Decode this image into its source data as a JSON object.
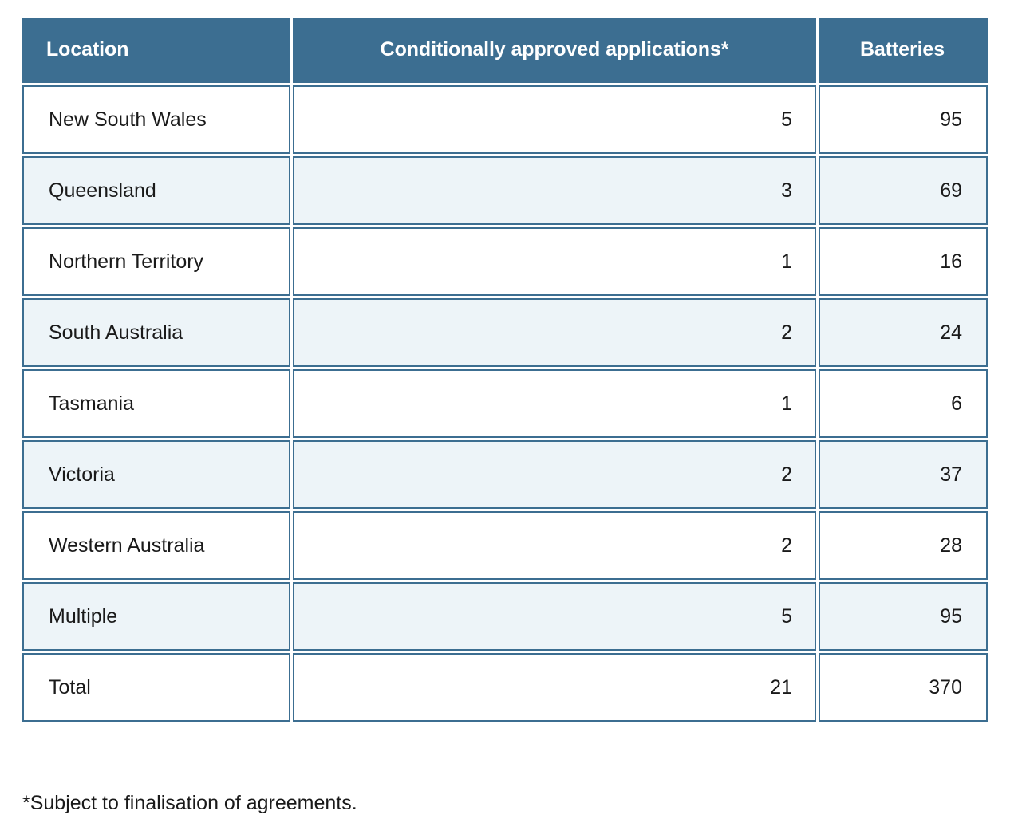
{
  "table": {
    "columns": [
      {
        "key": "location",
        "label": "Location",
        "align": "left"
      },
      {
        "key": "apps",
        "label": "Conditionally approved applications*",
        "align": "right"
      },
      {
        "key": "batteries",
        "label": "Batteries",
        "align": "right"
      }
    ],
    "header": {
      "location": "Location",
      "apps": "Conditionally approved applications*",
      "batteries": "Batteries"
    },
    "rows": [
      {
        "location": "New South Wales",
        "apps": "5",
        "batteries": "95",
        "shaded": false
      },
      {
        "location": "Queensland",
        "apps": "3",
        "batteries": "69",
        "shaded": true
      },
      {
        "location": "Northern Territory",
        "apps": "1",
        "batteries": "16",
        "shaded": false
      },
      {
        "location": "South Australia",
        "apps": "2",
        "batteries": "24",
        "shaded": true
      },
      {
        "location": "Tasmania",
        "apps": "1",
        "batteries": "6",
        "shaded": false
      },
      {
        "location": "Victoria",
        "apps": "2",
        "batteries": "37",
        "shaded": true
      },
      {
        "location": "Western Australia",
        "apps": "2",
        "batteries": "28",
        "shaded": false
      },
      {
        "location": "Multiple",
        "apps": "5",
        "batteries": "95",
        "shaded": true
      },
      {
        "location": "Total",
        "apps": "21",
        "batteries": "370",
        "shaded": false
      }
    ]
  },
  "footnote": "*Subject to finalisation of agreements.",
  "colors": {
    "header_background": "#3c6e91",
    "header_text": "#ffffff",
    "cell_border": "#3c6e91",
    "row_shaded_background": "#edf4f8",
    "row_plain_background": "#ffffff",
    "body_text": "#1a1a1a",
    "page_background": "#ffffff"
  },
  "chart_data": {
    "type": "table",
    "title": "",
    "categories": [
      "New South Wales",
      "Queensland",
      "Northern Territory",
      "South Australia",
      "Tasmania",
      "Victoria",
      "Western Australia",
      "Multiple",
      "Total"
    ],
    "series": [
      {
        "name": "Conditionally approved applications*",
        "values": [
          5,
          3,
          1,
          2,
          1,
          2,
          2,
          5,
          21
        ]
      },
      {
        "name": "Batteries",
        "values": [
          95,
          69,
          16,
          24,
          6,
          37,
          28,
          95,
          370
        ]
      }
    ]
  }
}
